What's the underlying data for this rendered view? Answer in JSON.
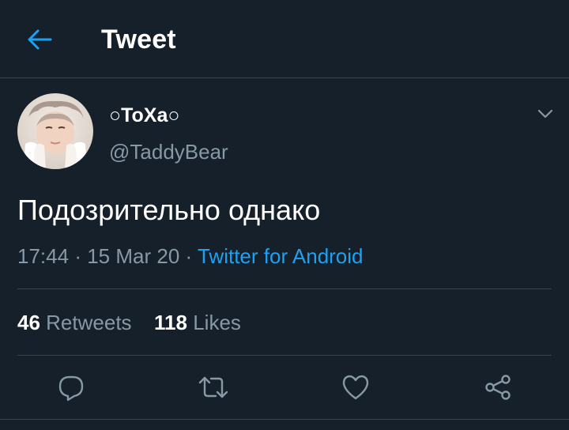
{
  "header": {
    "title": "Tweet",
    "back_icon": "arrow-left-icon"
  },
  "tweet": {
    "display_name": "○ToXa○",
    "handle": "@TaddyBear",
    "text": "Подозрительно однако",
    "time": "17:44",
    "date": "15 Mar 20",
    "separator": "·",
    "source": "Twitter for Android"
  },
  "stats": {
    "retweets_count": "46",
    "retweets_label": "Retweets",
    "likes_count": "118",
    "likes_label": "Likes"
  },
  "actions": [
    "reply-icon",
    "retweet-icon",
    "like-icon",
    "share-icon"
  ],
  "colors": {
    "background": "#15202b",
    "accent": "#1da1f2",
    "secondary_text": "#8899a6",
    "divider": "#38444d"
  }
}
